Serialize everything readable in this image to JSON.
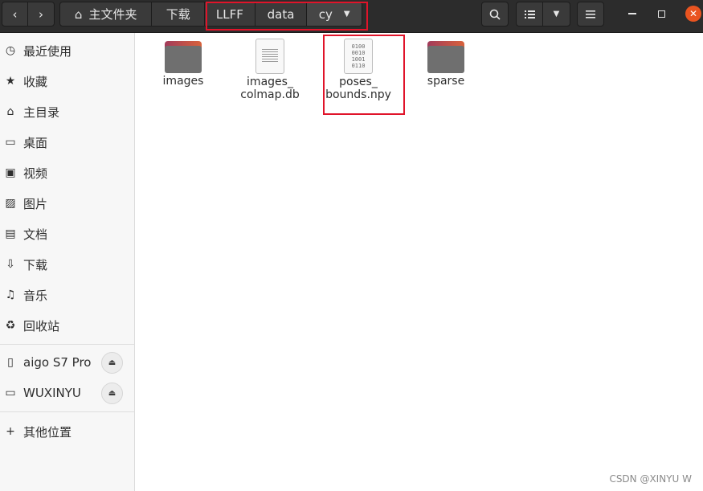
{
  "header": {
    "home_label": "主文件夹",
    "crumbs": [
      "下载",
      "LLFF",
      "data",
      "cy"
    ]
  },
  "sidebar": {
    "items": [
      {
        "label": "最近使用",
        "icon": "clock-icon"
      },
      {
        "label": "收藏",
        "icon": "star-icon"
      },
      {
        "label": "主目录",
        "icon": "home-icon"
      },
      {
        "label": "桌面",
        "icon": "desktop-icon"
      },
      {
        "label": "视频",
        "icon": "video-icon"
      },
      {
        "label": "图片",
        "icon": "picture-icon"
      },
      {
        "label": "文档",
        "icon": "document-icon"
      },
      {
        "label": "下载",
        "icon": "download-icon"
      },
      {
        "label": "音乐",
        "icon": "music-icon"
      },
      {
        "label": "回收站",
        "icon": "trash-icon"
      }
    ],
    "devices": [
      {
        "label": "aigo S7 Pro",
        "icon": "drive-icon"
      },
      {
        "label": "WUXINYU",
        "icon": "drive-icon"
      }
    ],
    "other": {
      "label": "其他位置",
      "icon": "plus-icon"
    }
  },
  "files": [
    {
      "label": "images",
      "type": "folder"
    },
    {
      "label": "images_\ncolmap.db",
      "type": "text-file"
    },
    {
      "label": "poses_\nbounds.npy",
      "type": "binary-file",
      "binary_glyph": "0100\n0010\n1001\n0110"
    },
    {
      "label": "sparse",
      "type": "folder"
    }
  ],
  "watermark": "CSDN @XINYU W",
  "colors": {
    "highlight_box": "#e0142a",
    "close_button": "#e95420"
  }
}
